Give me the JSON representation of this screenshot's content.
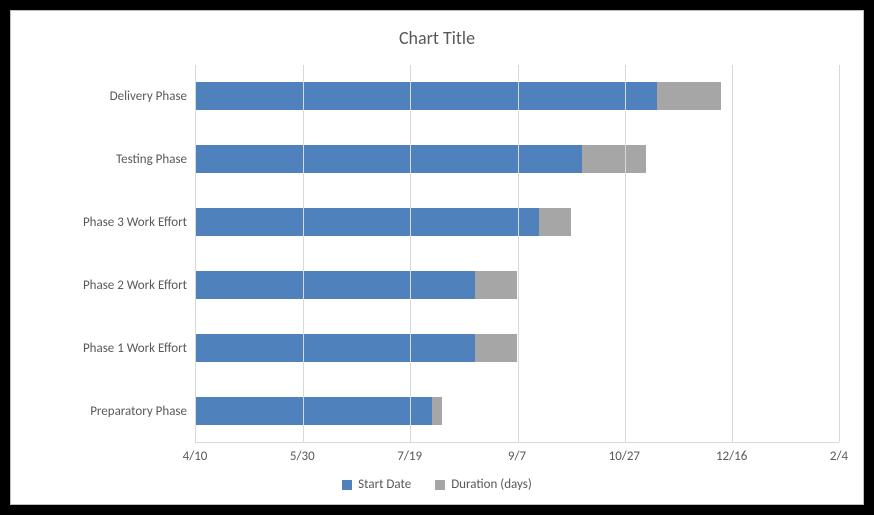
{
  "chart_data": {
    "type": "bar",
    "orientation": "horizontal",
    "stacked": true,
    "title": "Chart Title",
    "x_ticks": [
      "4/10",
      "5/30",
      "7/19",
      "9/7",
      "10/27",
      "12/16",
      "2/4"
    ],
    "x_axis_type": "date",
    "x_range_days": 300,
    "tick_interval_days": 50,
    "categories": [
      "Delivery Phase",
      "Testing Phase",
      "Phase 3 Work Effort",
      "Phase 2 Work Effort",
      "Phase 1 Work Effort",
      "Preparatory Phase"
    ],
    "series": [
      {
        "name": "Start Date",
        "color": "#4f81bd",
        "values": [
          215,
          180,
          160,
          130,
          130,
          110
        ]
      },
      {
        "name": "Duration (days)",
        "color": "#a6a6a6",
        "values": [
          30,
          30,
          15,
          20,
          20,
          5
        ]
      }
    ],
    "legend": {
      "position": "bottom",
      "items": [
        "Start Date",
        "Duration (days)"
      ]
    }
  }
}
